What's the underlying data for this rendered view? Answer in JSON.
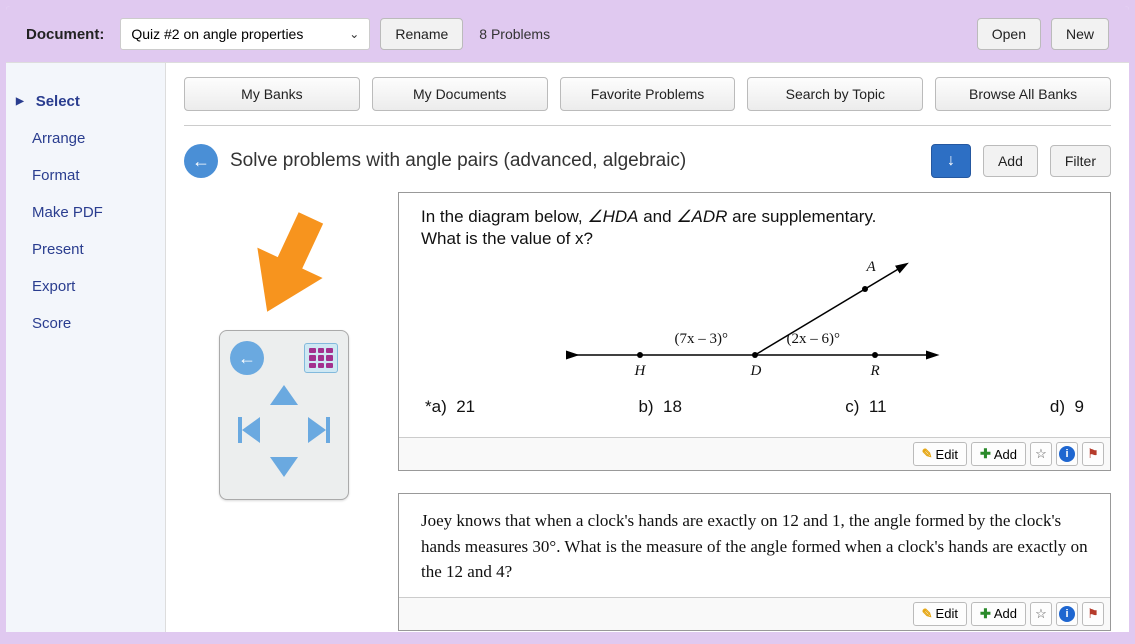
{
  "topbar": {
    "label": "Document:",
    "doc_name": "Quiz #2 on angle properties",
    "rename": "Rename",
    "problem_count": "8 Problems",
    "open": "Open",
    "new": "New"
  },
  "sidebar": {
    "items": [
      "Select",
      "Arrange",
      "Format",
      "Make PDF",
      "Present",
      "Export",
      "Score"
    ],
    "selected_index": 0
  },
  "tabs": [
    "My Banks",
    "My Documents",
    "Favorite Problems",
    "Search by Topic",
    "Browse All Banks"
  ],
  "header": {
    "title": "Solve problems with angle pairs (advanced, algebraic)",
    "add": "Add",
    "filter": "Filter"
  },
  "problems": [
    {
      "intro_part1": "In the diagram below, ",
      "angle1": "∠HDA",
      "intro_mid": " and ",
      "angle2": "∠ADR",
      "intro_part2": " are supplementary.",
      "question": "What is the value of x?",
      "diagram": {
        "expr_left": "(7x – 3)°",
        "expr_right": "(2x – 6)°",
        "label_A": "A",
        "label_H": "H",
        "label_D": "D",
        "label_R": "R"
      },
      "choices": {
        "a_prefix": "*a)",
        "a": "21",
        "b_prefix": "b)",
        "b": "18",
        "c_prefix": "c)",
        "c": "11",
        "d_prefix": "d)",
        "d": "9"
      }
    },
    {
      "text": "Joey knows that when a clock's hands are exactly on 12 and 1, the angle formed by the clock's hands measures 30°.  What is the measure of the angle formed when a clock's hands are exactly on the 12 and 4?"
    }
  ],
  "actions": {
    "edit": "Edit",
    "add": "Add"
  }
}
